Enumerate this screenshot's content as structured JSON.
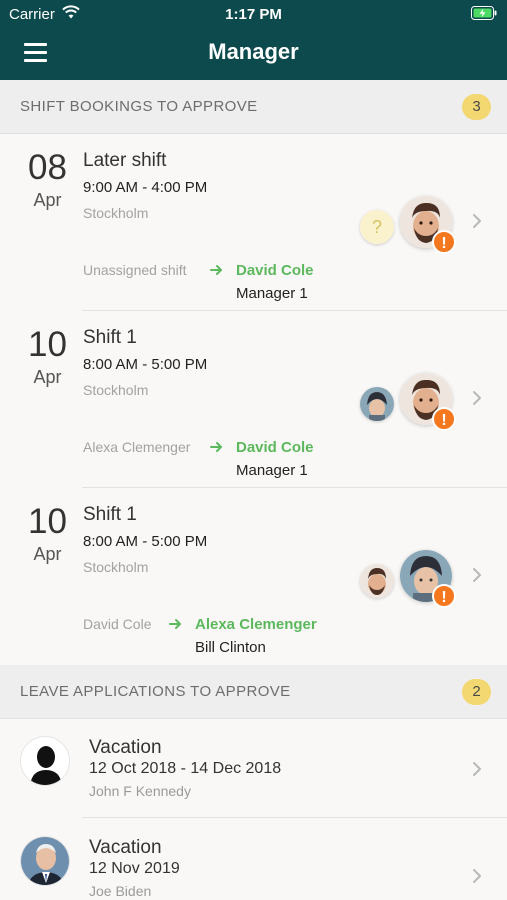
{
  "status_bar": {
    "carrier": "Carrier",
    "time": "1:17 PM"
  },
  "nav": {
    "title": "Manager",
    "menu_icon": "hamburger-menu-icon"
  },
  "shift_section": {
    "title": "SHIFT BOOKINGS TO APPROVE",
    "count": "3"
  },
  "shifts": [
    {
      "day": "08",
      "month": "Apr",
      "name": "Later shift",
      "time": "9:00 AM - 4:00 PM",
      "location": "Stockholm",
      "from": "Unassigned shift",
      "to": "David Cole",
      "approver": "Manager 1",
      "small_avatar": "question-mark",
      "small_avatar_text": "?",
      "big_avatar": "man-beard-avatar",
      "warning": "!"
    },
    {
      "day": "10",
      "month": "Apr",
      "name": "Shift 1",
      "time": "8:00 AM - 5:00 PM",
      "location": "Stockholm",
      "from": "Alexa Clemenger",
      "to": "David Cole",
      "approver": "Manager 1",
      "small_avatar": "woman-hat-avatar",
      "big_avatar": "man-beard-avatar",
      "warning": "!"
    },
    {
      "day": "10",
      "month": "Apr",
      "name": "Shift 1",
      "time": "8:00 AM - 5:00 PM",
      "location": "Stockholm",
      "from": "David Cole",
      "to": "Alexa Clemenger",
      "approver": "Bill Clinton",
      "small_avatar": "man-beard-avatar",
      "big_avatar": "woman-hat-avatar",
      "warning": "!"
    }
  ],
  "leave_section": {
    "title": "LEAVE APPLICATIONS TO APPROVE",
    "count": "2"
  },
  "leaves": [
    {
      "type": "Vacation",
      "dates": "12 Oct 2018 - 14 Dec 2018",
      "person": "John F Kennedy",
      "avatar": "silhouette-avatar"
    },
    {
      "type": "Vacation",
      "dates": "12 Nov 2019",
      "person": "Joe Biden",
      "avatar": "man-suit-avatar"
    }
  ],
  "colors": {
    "header_bg": "#0d4a4d",
    "accent_green": "#5cb85c",
    "badge_yellow": "#f3d872",
    "warning_orange": "#f5781f"
  }
}
